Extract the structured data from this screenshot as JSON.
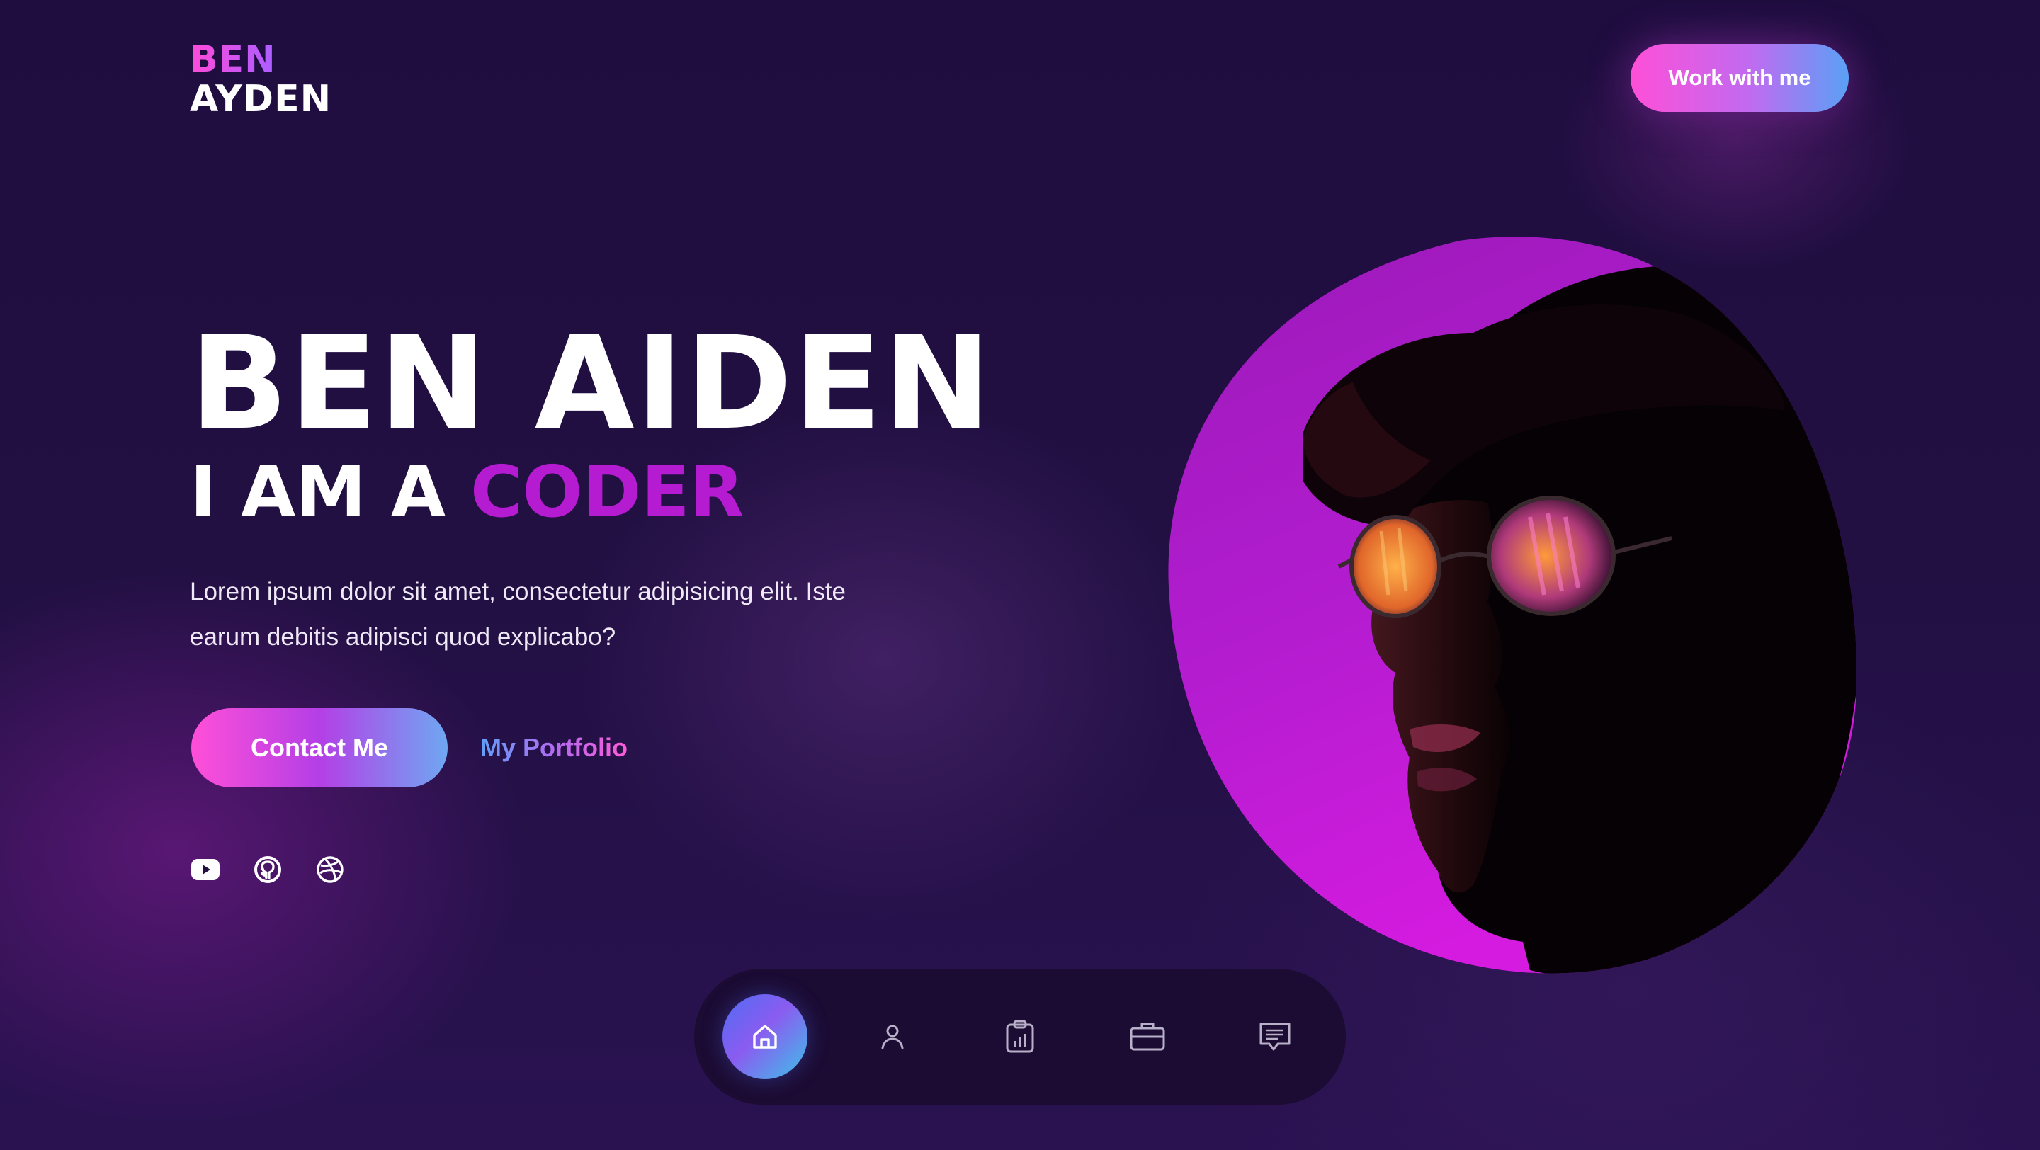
{
  "logo": {
    "line1": "BEN",
    "line2": "AYDEN"
  },
  "header": {
    "cta_label": "Work with me"
  },
  "hero": {
    "name": "BEN AIDEN",
    "subtitle_prefix": "I AM A ",
    "subtitle_accent": "CODER",
    "description": "Lorem ipsum dolor sit amet, consectetur adipisicing elit. Iste earum debitis adipisci quod explicabo?",
    "contact_label": "Contact Me",
    "portfolio_label": "My Portfolio"
  },
  "socials": [
    {
      "icon": "youtube-icon"
    },
    {
      "icon": "github-icon"
    },
    {
      "icon": "dribbble-icon"
    }
  ],
  "bottom_nav": {
    "items": [
      {
        "icon": "home-icon",
        "active": true
      },
      {
        "icon": "user-icon",
        "active": false
      },
      {
        "icon": "clipboard-chart-icon",
        "active": false
      },
      {
        "icon": "briefcase-icon",
        "active": false
      },
      {
        "icon": "message-icon",
        "active": false
      }
    ]
  },
  "colors": {
    "background": "#221043",
    "accent_pink": "#ff4fd8",
    "accent_purple": "#b51bd0",
    "accent_blue": "#5aa0f5"
  }
}
